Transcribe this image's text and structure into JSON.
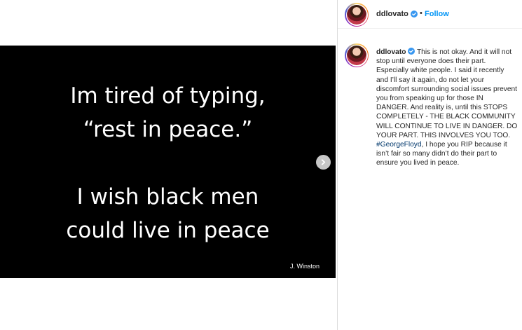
{
  "post": {
    "image_lines": [
      "Im tired of typing,",
      "“rest in peace.”",
      "I wish black men",
      "could live in peace"
    ],
    "credit": "J. Winston",
    "next_icon": "chevron-right-icon"
  },
  "header": {
    "username": "ddlovato",
    "verified_icon": "verified-badge-icon",
    "separator": "•",
    "follow_label": "Follow",
    "follow_color": "#0095f6"
  },
  "caption": {
    "username": "ddlovato",
    "text_before_hashtag": "This is not okay. And it will not stop until everyone does their part. Especially white people. I said it recently and I’ll say it again, do not let your discomfort surrounding social issues prevent you from speaking up for those IN DANGER. And reality is, until this STOPS COMPLETELY - THE BLACK COMMUNITY WILL CONTINUE TO LIVE IN DANGER. DO YOUR PART. THIS INVOLVES YOU TOO.",
    "hashtag": "#GeorgeFloyd",
    "text_after_hashtag": ", I hope you RIP because it isn’t fair so many didn’t do their part to ensure you lived in peace.",
    "hashtag_color": "#00376b"
  }
}
